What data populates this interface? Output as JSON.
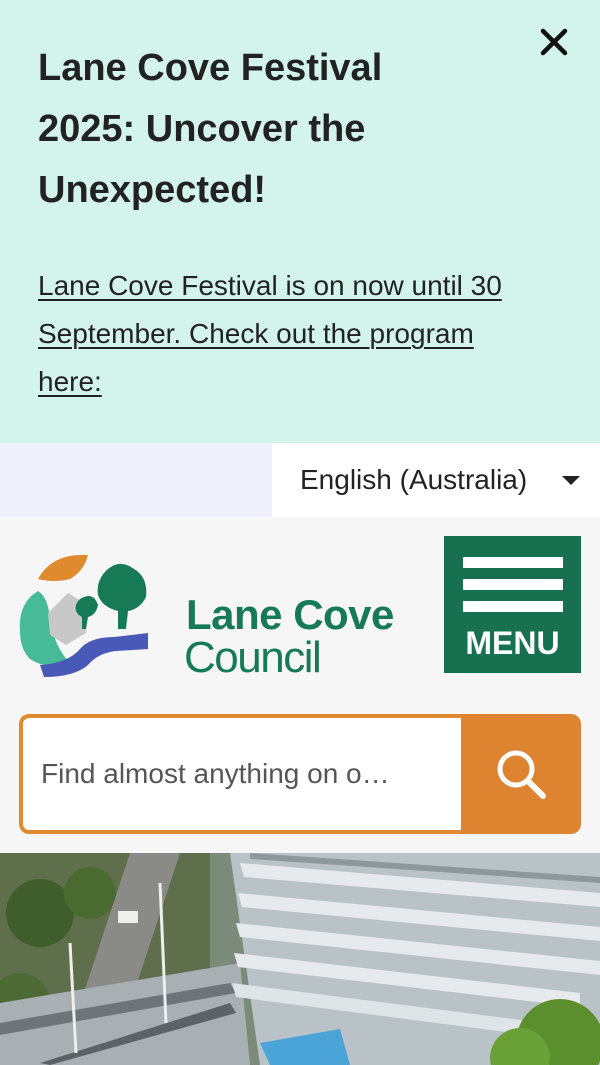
{
  "alert": {
    "title": "Lane Cove Festival 2025: Uncover the Unexpected!",
    "link_text": "Lane Cove Festival is on now until 30 September. Check out the program here:",
    "close_icon": "close-icon"
  },
  "language": {
    "selected": "English (Australia)",
    "caret_icon": "caret-down-icon"
  },
  "logo": {
    "line1": "Lane Cove",
    "line2": "Council",
    "brand_color": "#157a55"
  },
  "menu": {
    "label": "MENU",
    "color": "#17704f"
  },
  "search": {
    "placeholder": "Find almost anything on o…",
    "button_icon": "search-icon",
    "accent": "#de8431"
  },
  "hero": {
    "image": "aerial-photo-of-buildings"
  }
}
